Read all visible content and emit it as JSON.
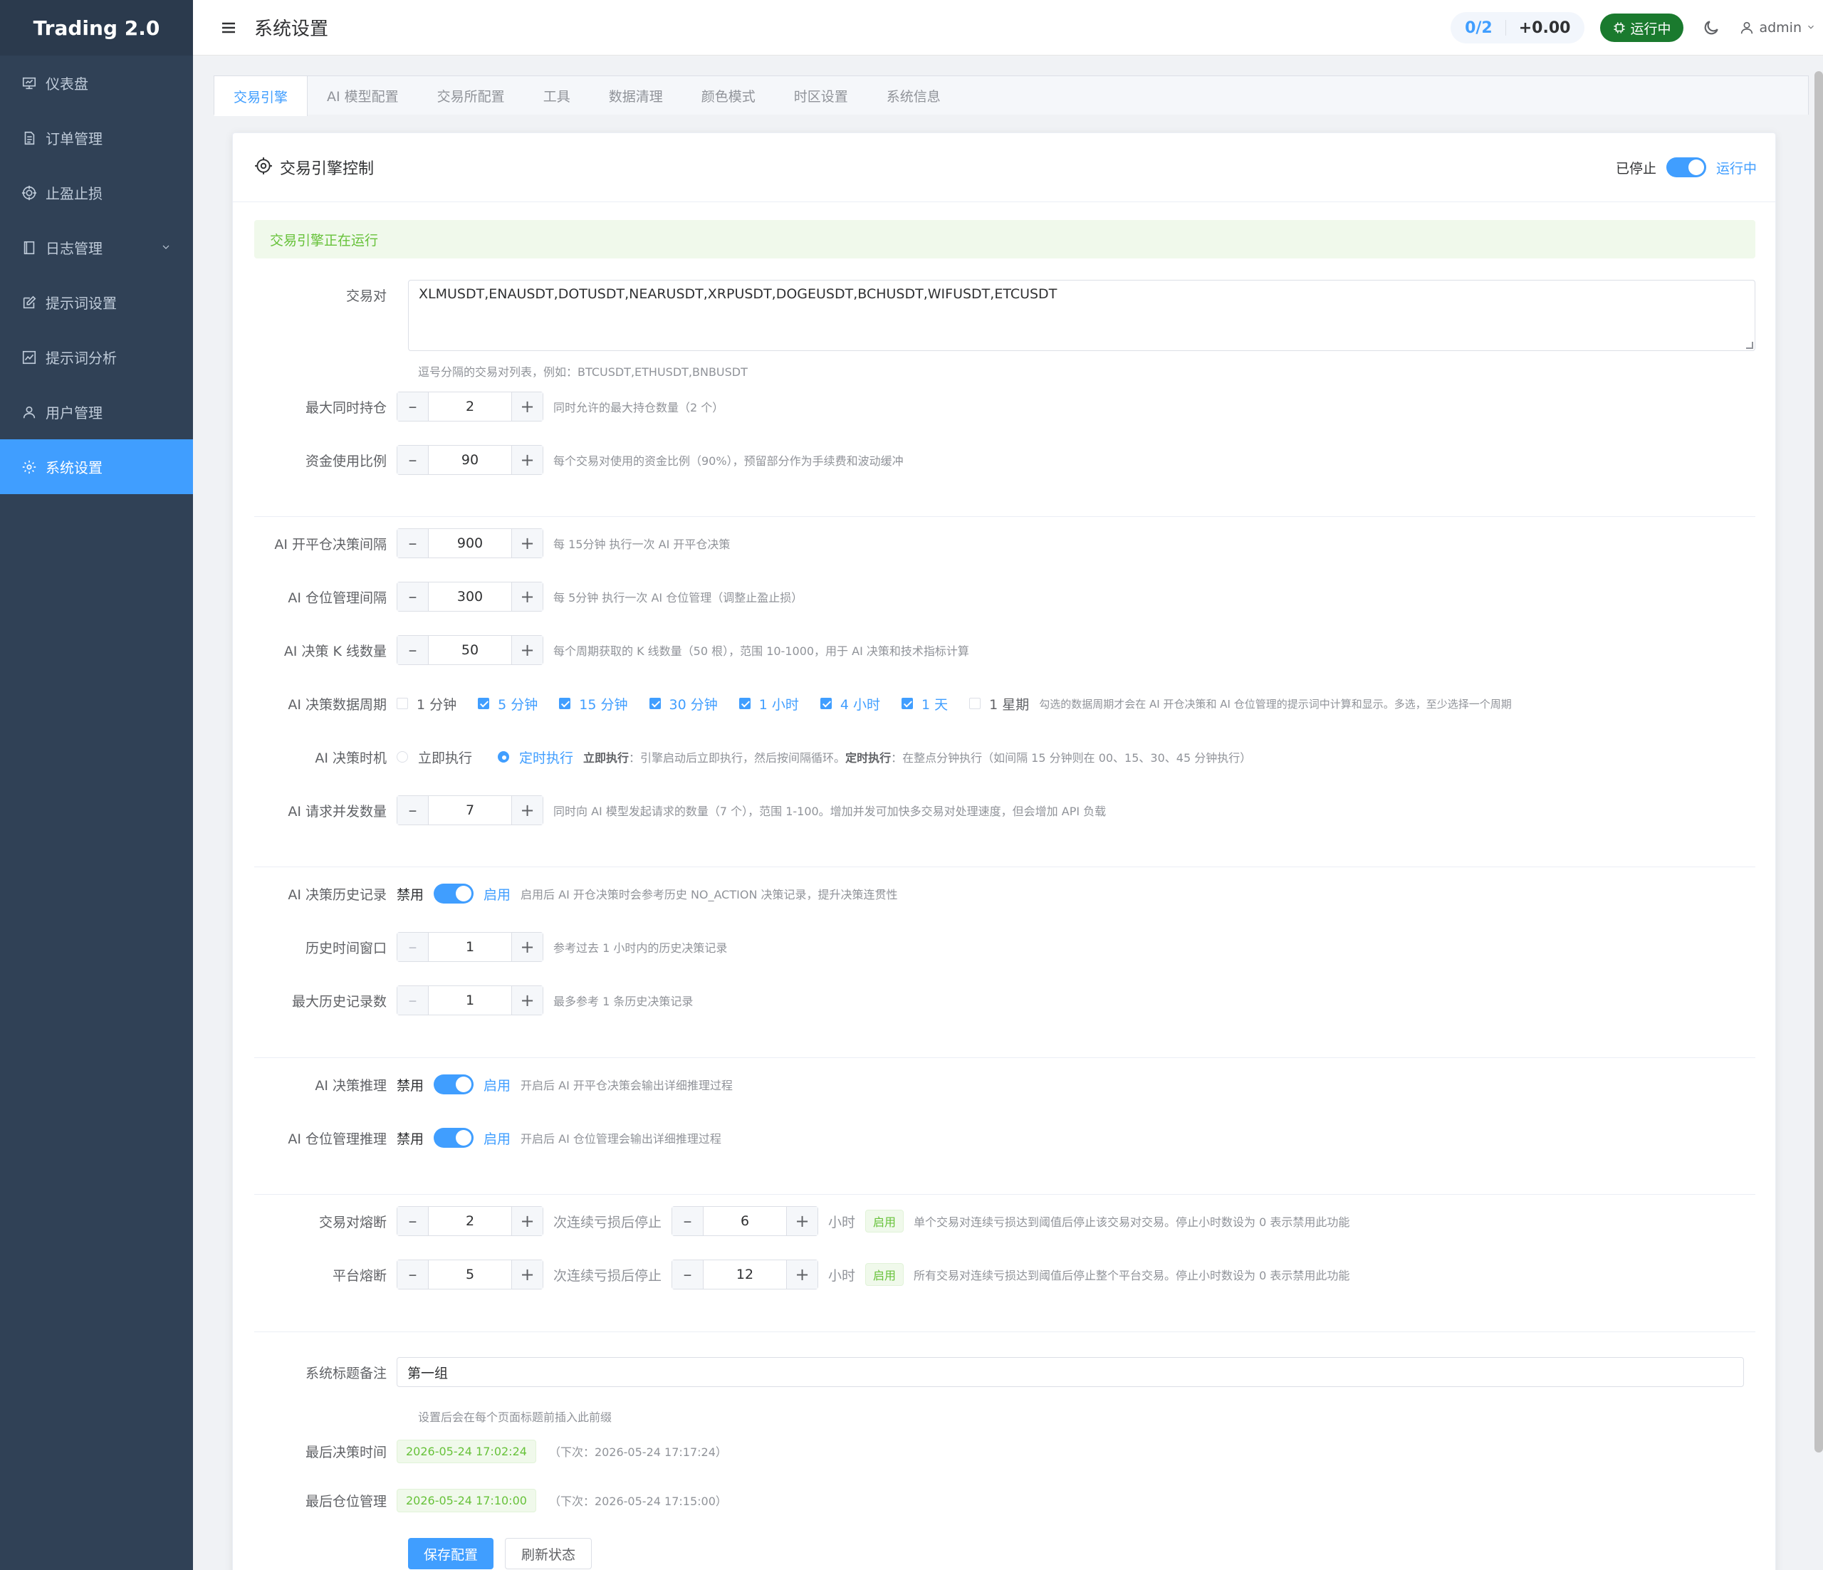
{
  "app": {
    "brand": "Trading 2.0"
  },
  "sidebar": {
    "items": [
      {
        "label": "仪表盘",
        "icon": "dashboard-icon"
      },
      {
        "label": "订单管理",
        "icon": "document-icon"
      },
      {
        "label": "止盈止损",
        "icon": "target-icon"
      },
      {
        "label": "日志管理",
        "icon": "notebook-icon"
      },
      {
        "label": "提示词设置",
        "icon": "edit-icon"
      },
      {
        "label": "提示词分析",
        "icon": "chart-icon"
      },
      {
        "label": "用户管理",
        "icon": "user-icon"
      },
      {
        "label": "系统设置",
        "icon": "gear-icon"
      }
    ]
  },
  "header": {
    "title": "系统设置",
    "positions": "0/2",
    "pnl": "+0.00",
    "status_button": "运行中",
    "username": "admin"
  },
  "tabs": [
    "交易引擎",
    "AI 模型配置",
    "交易所配置",
    "工具",
    "数据清理",
    "颜色模式",
    "时区设置",
    "系统信息"
  ],
  "card": {
    "title": "交易引擎控制",
    "switch_off_label": "已停止",
    "switch_on_label": "运行中",
    "engine_running": true,
    "alert": "交易引擎正在运行"
  },
  "form": {
    "pairs": {
      "label": "交易对",
      "value": "XLMUSDT,ENAUSDT,DOTUSDT,NEARUSDT,XRPUSDT,DOGEUSDT,BCHUSDT,WIFUSDT,ETCUSDT",
      "hint": "逗号分隔的交易对列表，例如：BTCUSDT,ETHUSDT,BNBUSDT"
    },
    "max_positions": {
      "label": "最大同时持仓",
      "value": "2",
      "hint": "同时允许的最大持仓数量（2 个）"
    },
    "capital_ratio": {
      "label": "资金使用比例",
      "value": "90",
      "hint": "每个交易对使用的资金比例（90%），预留部分作为手续费和波动缓冲"
    },
    "ai_open_interval": {
      "label": "AI 开平仓决策间隔",
      "value": "900",
      "hint": "每 15分钟 执行一次 AI 开平仓决策"
    },
    "ai_position_interval": {
      "label": "AI 仓位管理间隔",
      "value": "300",
      "hint": "每 5分钟 执行一次 AI 仓位管理（调整止盈止损）"
    },
    "ai_kline_count": {
      "label": "AI 决策 K 线数量",
      "value": "50",
      "hint": "每个周期获取的 K 线数量（50 根），范围 10-1000，用于 AI 决策和技术指标计算"
    },
    "ai_periods": {
      "label": "AI 决策数据周期",
      "options": [
        {
          "label": "1 分钟",
          "checked": false
        },
        {
          "label": "5 分钟",
          "checked": true
        },
        {
          "label": "15 分钟",
          "checked": true
        },
        {
          "label": "30 分钟",
          "checked": true
        },
        {
          "label": "1 小时",
          "checked": true
        },
        {
          "label": "4 小时",
          "checked": true
        },
        {
          "label": "1 天",
          "checked": true
        },
        {
          "label": "1 星期",
          "checked": false
        }
      ],
      "hint": "勾选的数据周期才会在 AI 开仓决策和 AI 仓位管理的提示词中计算和显示。多选，至少选择一个周期"
    },
    "ai_timing": {
      "label": "AI 决策时机",
      "options": [
        {
          "label": "立即执行",
          "checked": false
        },
        {
          "label": "定时执行",
          "checked": true
        }
      ],
      "hint_b1": "立即执行",
      "hint_t1": "：引擎启动后立即执行，然后按间隔循环。",
      "hint_b2": "定时执行",
      "hint_t2": "：在整点分钟执行（如间隔 15 分钟则在 00、15、30、45 分钟执行）"
    },
    "ai_concurrency": {
      "label": "AI 请求并发数量",
      "value": "7",
      "hint": "同时向 AI 模型发起请求的数量（7 个），范围 1-100。增加并发可加快多交易对处理速度，但会增加 API 负载"
    },
    "ai_history": {
      "label": "AI 决策历史记录",
      "off": "禁用",
      "on": "启用",
      "enabled": true,
      "hint": "启用后 AI 开仓决策时会参考历史 NO_ACTION 决策记录，提升决策连贯性"
    },
    "history_window": {
      "label": "历史时间窗口",
      "value": "1",
      "hint": "参考过去 1 小时内的历史决策记录"
    },
    "max_history": {
      "label": "最大历史记录数",
      "value": "1",
      "hint": "最多参考 1 条历史决策记录"
    },
    "ai_reasoning": {
      "label": "AI 决策推理",
      "off": "禁用",
      "on": "启用",
      "enabled": true,
      "hint": "开启后 AI 开平仓决策会输出详细推理过程"
    },
    "ai_pos_reasoning": {
      "label": "AI 仓位管理推理",
      "off": "禁用",
      "on": "启用",
      "enabled": true,
      "hint": "开启后 AI 仓位管理会输出详细推理过程"
    },
    "pair_breaker": {
      "label": "交易对熔断",
      "losses": "2",
      "losses_unit": "次连续亏损后停止",
      "hours": "6",
      "hours_unit": "小时",
      "tag": "启用",
      "hint": "单个交易对连续亏损达到阈值后停止该交易对交易。停止小时数设为 0 表示禁用此功能"
    },
    "platform_breaker": {
      "label": "平台熔断",
      "losses": "5",
      "losses_unit": "次连续亏损后停止",
      "hours": "12",
      "hours_unit": "小时",
      "tag": "启用",
      "hint": "所有交易对连续亏损达到阈值后停止整个平台交易。停止小时数设为 0 表示禁用此功能"
    },
    "title_note": {
      "label": "系统标题备注",
      "value": "第一组",
      "hint": "设置后会在每个页面标题前插入此前缀"
    },
    "last_decision": {
      "label": "最后决策时间",
      "time": "2026-05-24 17:02:24",
      "next": "（下次：2026-05-24 17:17:24）"
    },
    "last_position": {
      "label": "最后仓位管理",
      "time": "2026-05-24 17:10:00",
      "next": "（下次：2026-05-24 17:15:00）"
    }
  },
  "buttons": {
    "save": "保存配置",
    "refresh": "刷新状态"
  }
}
